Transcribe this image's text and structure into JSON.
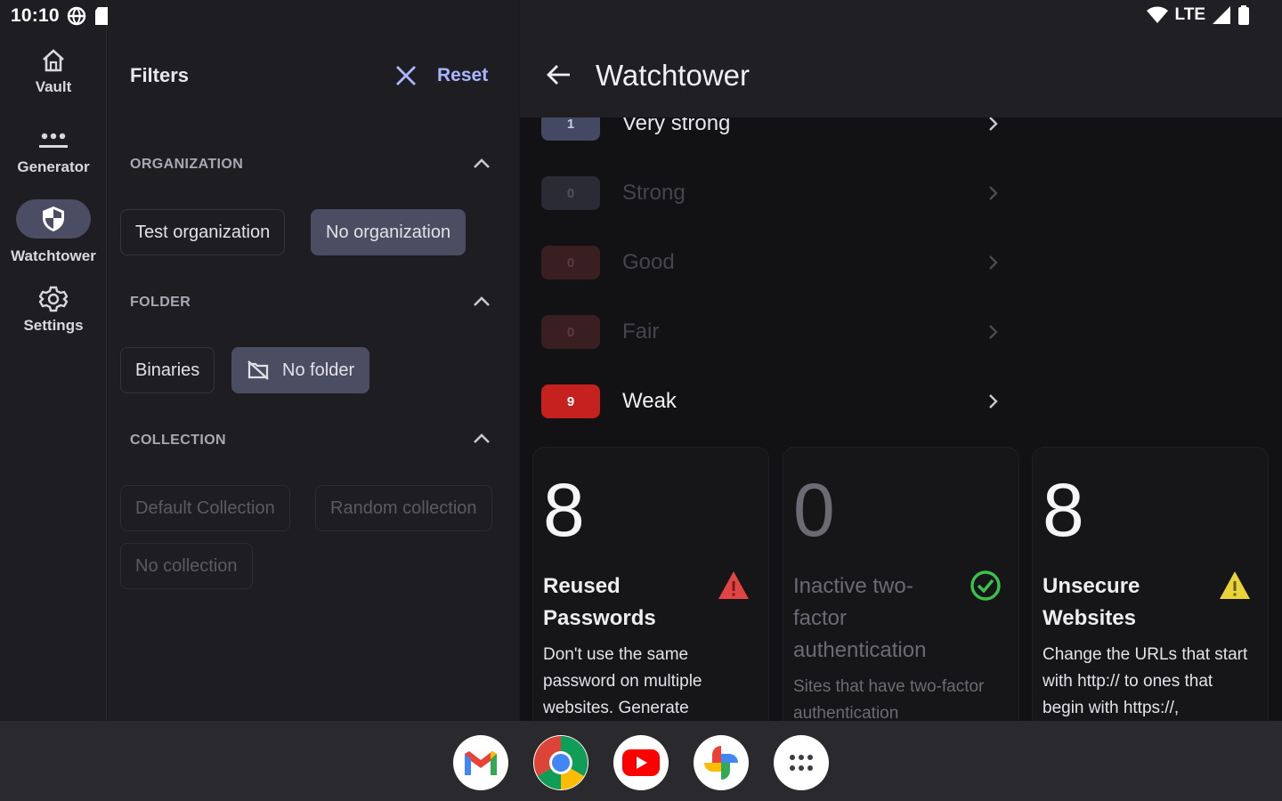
{
  "status_bar": {
    "time": "10:10",
    "network": "LTE",
    "icons": [
      "vpn-globe-icon",
      "sd-card-icon",
      "wifi-icon",
      "signal-icon",
      "battery-icon"
    ]
  },
  "nav_rail": {
    "items": [
      {
        "label": "Vault",
        "icon": "home-icon",
        "active": false
      },
      {
        "label": "Generator",
        "icon": "password-dots-icon",
        "active": false
      },
      {
        "label": "Watchtower",
        "icon": "shield-icon",
        "active": true
      },
      {
        "label": "Settings",
        "icon": "gear-icon",
        "active": false
      }
    ]
  },
  "filters": {
    "title": "Filters",
    "reset_label": "Reset",
    "sections": [
      {
        "title": "ORGANIZATION",
        "chips": [
          {
            "label": "Test organization",
            "state": "normal"
          },
          {
            "label": "No organization",
            "state": "selected"
          }
        ]
      },
      {
        "title": "FOLDER",
        "chips": [
          {
            "label": "Binaries",
            "state": "normal"
          },
          {
            "label": "No folder",
            "state": "selected",
            "icon": "folder-off-icon"
          }
        ]
      },
      {
        "title": "COLLECTION",
        "chips": [
          {
            "label": "Default Collection",
            "state": "disabled"
          },
          {
            "label": "Random collection",
            "state": "disabled"
          },
          {
            "label": "No collection",
            "state": "disabled"
          }
        ]
      }
    ]
  },
  "watchtower": {
    "title": "Watchtower",
    "strength_rows": [
      {
        "count": "1",
        "label": "Very strong",
        "badge_bg": "#444862",
        "badge_fg": "#c9cbe2",
        "label_color": "#e8e8ec",
        "dim": false
      },
      {
        "count": "0",
        "label": "Strong",
        "badge_bg": "#2a2b34",
        "badge_fg": "#4f5060",
        "label_color": "#45454d",
        "dim": true
      },
      {
        "count": "0",
        "label": "Good",
        "badge_bg": "#3a1f22",
        "badge_fg": "#5e3a3e",
        "label_color": "#45454d",
        "dim": true
      },
      {
        "count": "0",
        "label": "Fair",
        "badge_bg": "#3a1f22",
        "badge_fg": "#5e3a3e",
        "label_color": "#45454d",
        "dim": true
      },
      {
        "count": "9",
        "label": "Weak",
        "badge_bg": "#c5211f",
        "badge_fg": "#ffffff",
        "label_color": "#f0f0f3",
        "dim": false
      }
    ],
    "cards": [
      {
        "count": "8",
        "title": "Reused Passwords",
        "description": "Don't use the same password on multiple websites. Generate",
        "icon": "warning-red-icon",
        "dim": false
      },
      {
        "count": "0",
        "title": "Inactive two-factor authentication",
        "description": "Sites that have two-factor authentication",
        "icon": "check-circle-icon",
        "dim": true
      },
      {
        "count": "8",
        "title": "Unsecure Websites",
        "description": "Change the URLs that start with http:// to ones that begin with https://,",
        "icon": "warning-yellow-icon",
        "dim": false
      }
    ]
  },
  "taskbar": {
    "apps": [
      "gmail-icon",
      "chrome-icon",
      "youtube-icon",
      "photos-icon",
      "app-drawer-icon"
    ]
  },
  "colors": {
    "accent": "#aab4ff",
    "selected_chip": "#4b4e63",
    "weak_red": "#c5211f",
    "warning_red": "#e04545",
    "warning_yellow": "#e9d23a",
    "check_green": "#3cc24a"
  }
}
